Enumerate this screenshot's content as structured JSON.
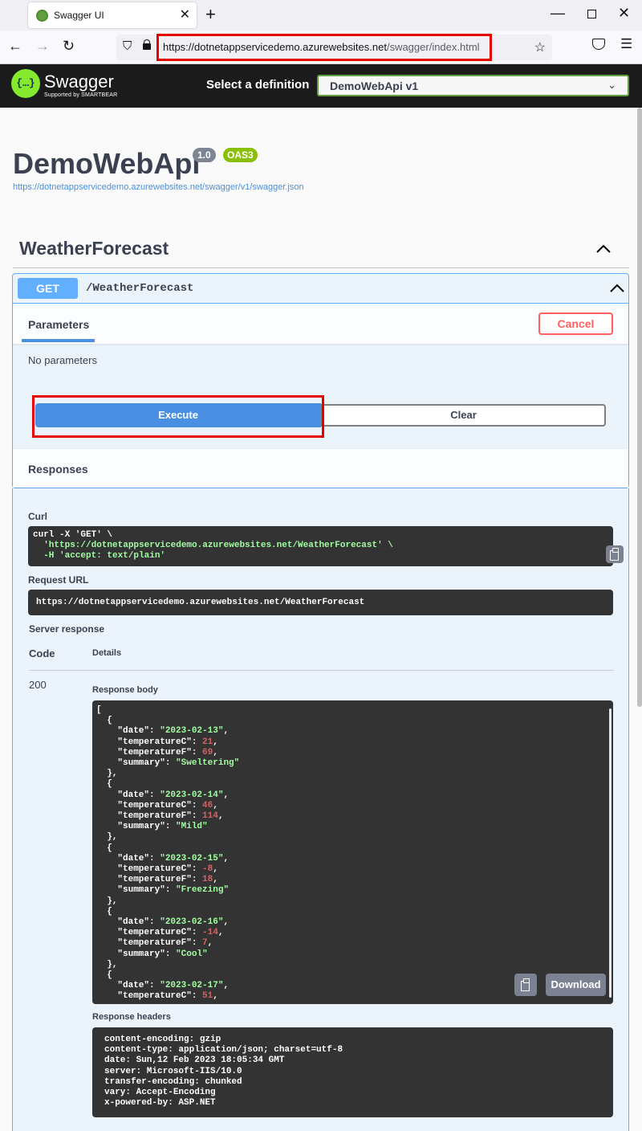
{
  "browser": {
    "tab_title": "Swagger UI",
    "url_host": "https://dotnetappservicedemo.azurewebsites.net",
    "url_path": "/swagger/index.html"
  },
  "topbar": {
    "logo_text": "Swagger",
    "logo_sub": "Supported by SMARTBEAR",
    "select_label": "Select a definition",
    "select_value": "DemoWebApi v1"
  },
  "info": {
    "title": "DemoWebApi",
    "version": "1.0",
    "oas": "OAS3",
    "spec_url": "https://dotnetappservicedemo.azurewebsites.net/swagger/v1/swagger.json"
  },
  "tag": {
    "name": "WeatherForecast"
  },
  "operation": {
    "method": "GET",
    "path": "/WeatherForecast",
    "parameters_tab": "Parameters",
    "cancel_label": "Cancel",
    "no_params": "No parameters",
    "execute_label": "Execute",
    "clear_label": "Clear",
    "responses_title": "Responses"
  },
  "response": {
    "curl_label": "Curl",
    "curl_lines": [
      "curl -X 'GET' \\",
      "  'https://dotnetappservicedemo.azurewebsites.net/WeatherForecast' \\",
      "  -H 'accept: text/plain'"
    ],
    "request_url_label": "Request URL",
    "request_url": "https://dotnetappservicedemo.azurewebsites.net/WeatherForecast",
    "server_response_label": "Server response",
    "code_header": "Code",
    "details_header": "Details",
    "code": "200",
    "body_label": "Response body",
    "body_items": [
      {
        "date": "2023-02-13",
        "temperatureC": "21",
        "temperatureF": "69",
        "summary": "Sweltering"
      },
      {
        "date": "2023-02-14",
        "temperatureC": "46",
        "temperatureF": "114",
        "summary": "Mild"
      },
      {
        "date": "2023-02-15",
        "temperatureC": "-8",
        "temperatureF": "18",
        "summary": "Freezing"
      },
      {
        "date": "2023-02-16",
        "temperatureC": "-14",
        "temperatureF": "7",
        "summary": "Cool"
      },
      {
        "date": "2023-02-17",
        "temperatureC": "51"
      }
    ],
    "download_label": "Download",
    "headers_label": "Response headers",
    "headers": [
      "content-encoding: gzip",
      "content-type: application/json; charset=utf-8",
      "date: Sun,12 Feb 2023 18:05:34 GMT",
      "server: Microsoft-IIS/10.0",
      "transfer-encoding: chunked",
      "vary: Accept-Encoding",
      "x-powered-by: ASP.NET"
    ]
  }
}
